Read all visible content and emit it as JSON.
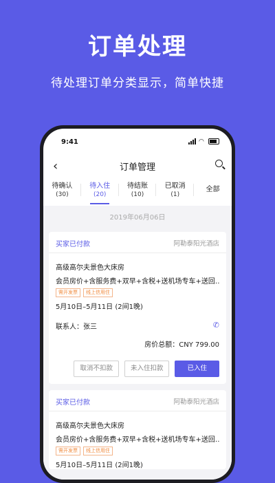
{
  "hero": {
    "title": "订单处理",
    "subtitle": "待处理订单分类显示，简单快捷"
  },
  "status_bar": {
    "time": "9:41"
  },
  "navbar": {
    "back_icon": "chevron-left-icon",
    "title": "订单管理",
    "search_icon": "search-icon"
  },
  "tabs": [
    {
      "label": "待确认",
      "count": "(30)"
    },
    {
      "label": "待入住",
      "count": "(20)",
      "active": true
    },
    {
      "label": "待结账",
      "count": "(10)"
    },
    {
      "label": "已取消",
      "count": "(1)"
    },
    {
      "label": "全部"
    }
  ],
  "date_header": "2019年06月06日",
  "orders": [
    {
      "status": "买家已付款",
      "hotel": "阿勒泰阳光酒店",
      "room": "高级高尔夫景色大床房",
      "rate": "会员房价+含服务费+双早+含税+送机场专车+送回…",
      "tags": [
        "需开发票",
        "线上信用住"
      ],
      "dates": "5月10日–5月11日 (2间1晚)",
      "contact": "联系人：张三",
      "total": "房价总额：CNY 799.00",
      "buttons": {
        "cancel": "取消不扣款",
        "noshow": "未入住扣款",
        "checkin": "已入住"
      }
    },
    {
      "status": "买家已付款",
      "hotel": "阿勒泰阳光酒店",
      "room": "高级高尔夫景色大床房",
      "rate": "会员房价+含服务费+双早+含税+送机场专车+送回…",
      "tags": [
        "需开发票",
        "线上信用住"
      ],
      "dates": "5月10日–5月11日 (2间1晚)"
    }
  ],
  "colors": {
    "brand": "#5a5be6",
    "tag": "#f08a3c"
  }
}
